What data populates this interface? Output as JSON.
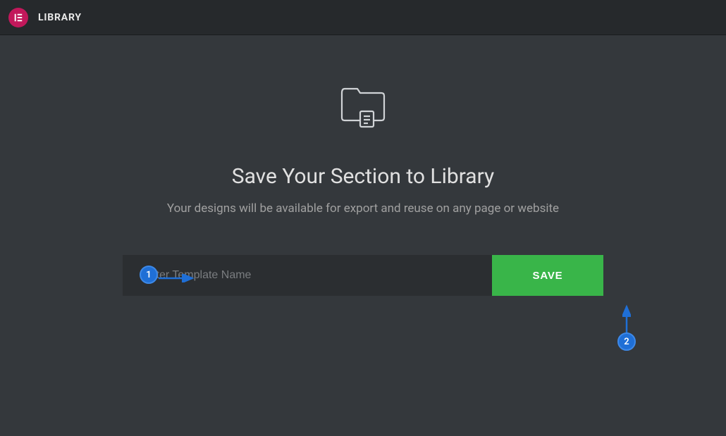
{
  "header": {
    "title": "LIBRARY"
  },
  "main": {
    "title": "Save Your Section to Library",
    "subtitle": "Your designs will be available for export and reuse on any page or website",
    "input_placeholder": "Enter Template Name",
    "input_value": "",
    "save_label": "SAVE"
  },
  "annotations": {
    "marker1": "1",
    "marker2": "2"
  }
}
